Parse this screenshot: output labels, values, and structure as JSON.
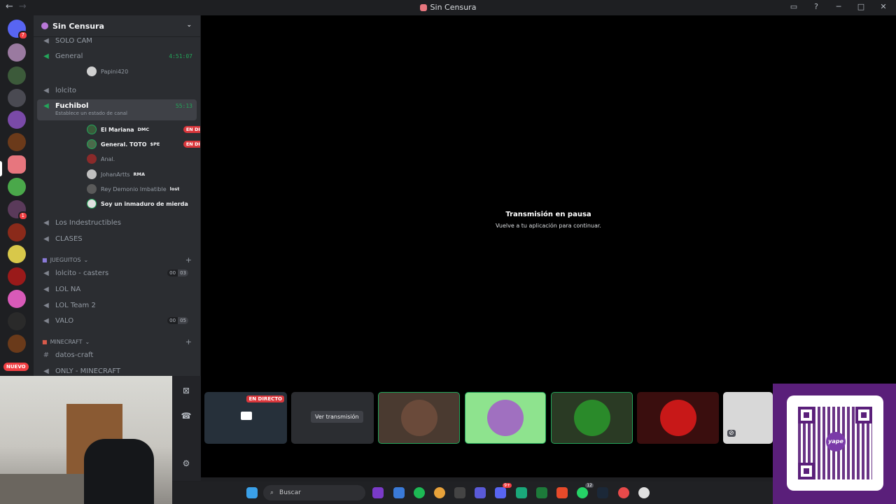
{
  "window": {
    "title": "Sin Censura",
    "back": "←",
    "forward": "→"
  },
  "titlebar_icons": {
    "inbox": "▭",
    "help": "?",
    "minimize": "─",
    "maximize": "□",
    "close": "✕"
  },
  "rail": {
    "home_badge": "7",
    "unread_badge": "1",
    "nuevo": "NUEVO"
  },
  "server": {
    "name": "Sin Censura",
    "chevron": "⌄"
  },
  "channels": {
    "solo_cam": "SOLO CAM",
    "general": {
      "name": "General",
      "timer": "4:51:07"
    },
    "general_user": "Papini420",
    "lolcito": "lolcito",
    "fuchibol": {
      "name": "Fuchibol",
      "timer": "55:13",
      "status": "Establece un estado de canal"
    },
    "fuchibol_users": [
      {
        "name": "El Mariana",
        "tag": "DMC",
        "live": "EN DIRECTO"
      },
      {
        "name": "General. TOTO",
        "tag": "$PE",
        "live": "EN DIRECTO"
      },
      {
        "name": "Anal.",
        "tag": "",
        "live": ""
      },
      {
        "name": "JohanArtts",
        "tag": "RMA",
        "live": ""
      },
      {
        "name": "Rey Demonio Imbatible",
        "tag": "lost",
        "live": ""
      },
      {
        "name": "Soy un inmaduro de mierda",
        "tag": "",
        "live": ""
      }
    ],
    "los_indestructibles": "Los Indestructibles",
    "clases": "CLASES",
    "cat_jueguitos": "JUEGUITOS",
    "lolcito_casters": {
      "name": "lolcito - casters",
      "cap": [
        "00",
        "03"
      ]
    },
    "lol_na": "LOL NA",
    "lol_team2": "LOL Team 2",
    "valo": {
      "name": "VALO",
      "cap": [
        "00",
        "05"
      ]
    },
    "cat_minecraft": "MINECRAFT",
    "datos_craft": "datos-craft",
    "only_minecraft": "ONLY - MINECRAFT"
  },
  "stage": {
    "pause_title": "Transmisión en pausa",
    "pause_sub": "Vuelve a tu aplicación para continuar.",
    "tile_live": "EN DIRECTO",
    "watch_button": "Ver transmisión"
  },
  "taskbar": {
    "search": "Buscar",
    "badge_discord": "9+",
    "badge_whatsapp": "12"
  },
  "qr": {
    "brand": "yape"
  }
}
